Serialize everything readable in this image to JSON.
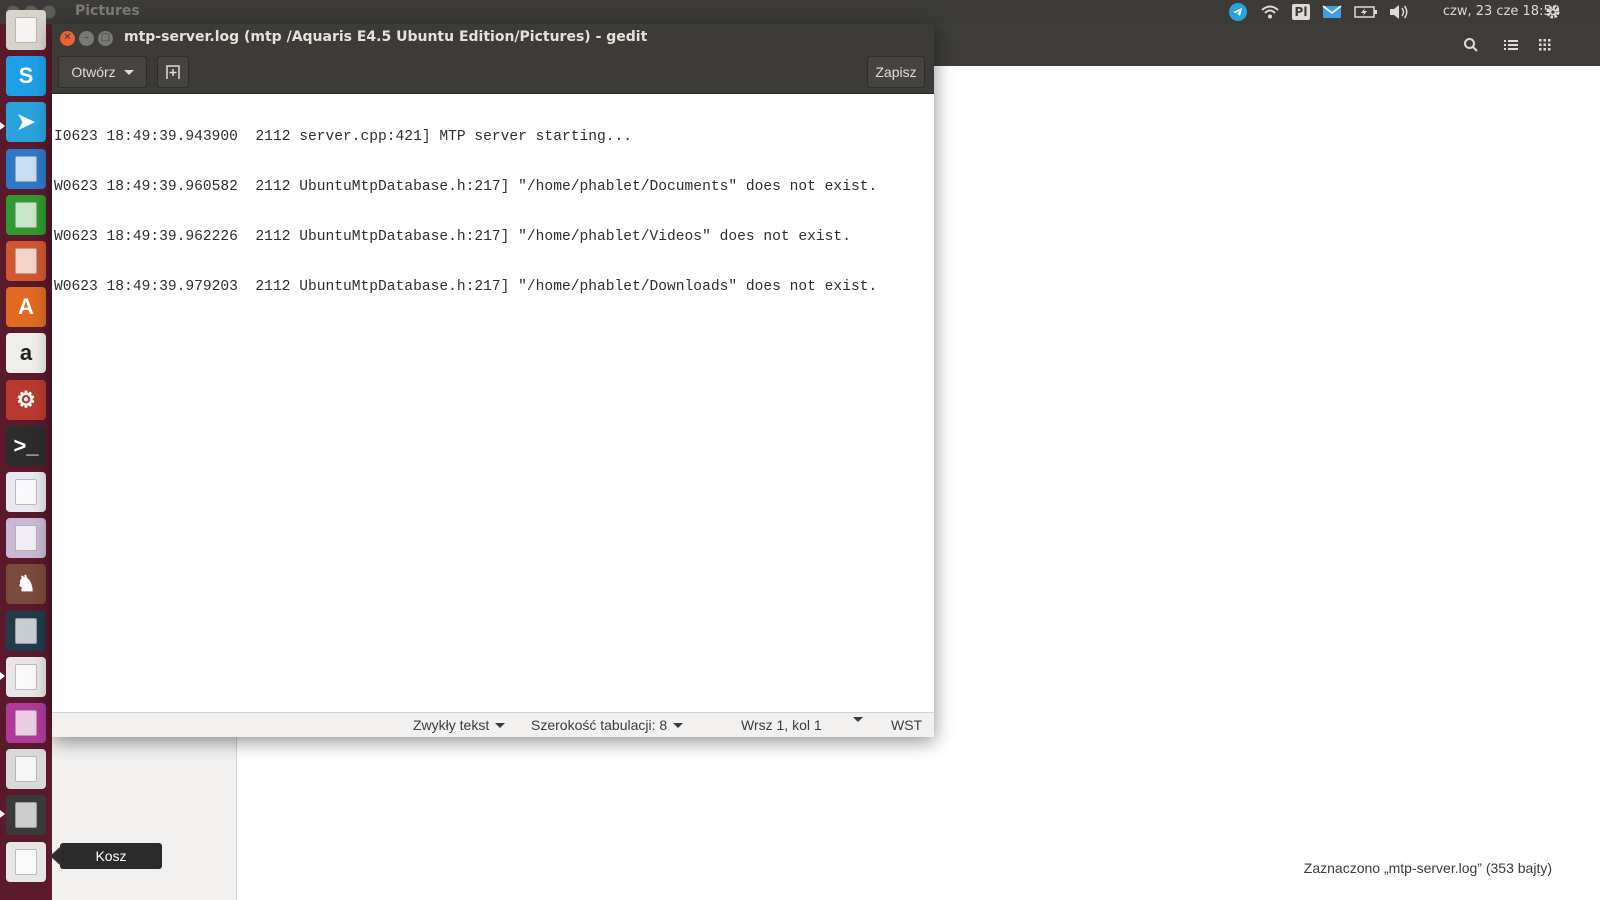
{
  "top_panel": {
    "background_window_title": "Pictures",
    "keyboard_layout": "Pl",
    "clock": "czw, 23 cze 18:59",
    "indicators": [
      "telegram-icon",
      "wifi-icon",
      "keyboard-layout-indicator",
      "mail-icon",
      "battery-icon",
      "volume-icon",
      "gear-icon"
    ]
  },
  "launcher": {
    "items": [
      {
        "name": "files-icon"
      },
      {
        "name": "skype-icon",
        "glyph": "S",
        "color": "#1ea0e6"
      },
      {
        "name": "telegram-icon",
        "glyph": "➤",
        "color": "#2aa3dd"
      },
      {
        "name": "libreoffice-writer-icon",
        "color": "#2d78c8"
      },
      {
        "name": "libreoffice-calc-icon",
        "color": "#2f9a2f"
      },
      {
        "name": "libreoffice-impress-icon",
        "color": "#d2562e"
      },
      {
        "name": "software-center-icon",
        "glyph": "A",
        "color": "#e06a22"
      },
      {
        "name": "amazon-icon",
        "glyph": "a",
        "color": "#f0eeea"
      },
      {
        "name": "system-settings-icon",
        "glyph": "⚙",
        "color": "#b83a2e"
      },
      {
        "name": "terminal-icon",
        "glyph": ">_",
        "color": "#2c2c2c"
      },
      {
        "name": "solitaire-icon",
        "color": "#e8e8f0"
      },
      {
        "name": "webcam-icon",
        "color": "#c9b9d6"
      },
      {
        "name": "chess-icon",
        "glyph": "♞",
        "color": "#7a4a3a"
      },
      {
        "name": "system-monitor-icon",
        "color": "#223a4a"
      },
      {
        "name": "gedit-icon",
        "color": "#e6e6e6"
      },
      {
        "name": "workspace-switcher-icon",
        "color": "#b03a9a"
      },
      {
        "name": "drive-icon",
        "color": "#d9d9d9"
      },
      {
        "name": "phone-device-icon",
        "color": "#3a3a3a"
      },
      {
        "name": "trash-icon",
        "color": "#e6e6e6"
      }
    ],
    "tooltip": "Kosz"
  },
  "file_manager": {
    "status": "Zaznaczono „mtp-server.log” (353 bajty)"
  },
  "gedit": {
    "title": "mtp-server.log (mtp /Aquaris E4.5 Ubuntu Edition/Pictures) - gedit",
    "toolbar": {
      "open_label": "Otwórz",
      "save_label": "Zapisz"
    },
    "lines": [
      "I0623 18:49:39.943900  2112 server.cpp:421] MTP server starting...",
      "W0623 18:49:39.960582  2112 UbuntuMtpDatabase.h:217] \"/home/phablet/Documents\" does not exist.",
      "W0623 18:49:39.962226  2112 UbuntuMtpDatabase.h:217] \"/home/phablet/Videos\" does not exist.",
      "W0623 18:49:39.979203  2112 UbuntuMtpDatabase.h:217] \"/home/phablet/Downloads\" does not exist."
    ],
    "status": {
      "language": "Zwykły tekst",
      "tab_width": "Szerokość tabulacji: 8",
      "cursor_position": "Wrsz 1, kol 1",
      "insert_mode": "WST"
    }
  }
}
